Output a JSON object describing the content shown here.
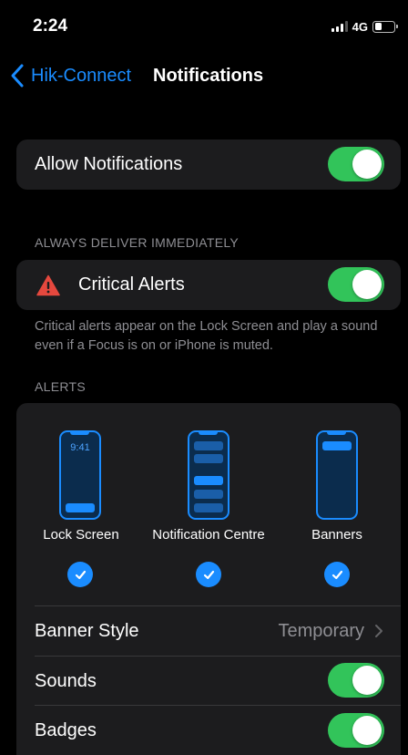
{
  "status_bar": {
    "time": "2:24",
    "network": "4G"
  },
  "nav": {
    "back_label": "Hik-Connect",
    "title": "Notifications"
  },
  "allow": {
    "label": "Allow Notifications",
    "on": true
  },
  "always_deliver": {
    "header": "ALWAYS DELIVER IMMEDIATELY",
    "critical_label": "Critical Alerts",
    "on": true,
    "footer": "Critical alerts appear on the Lock Screen and play a sound even if a Focus is on or iPhone is muted."
  },
  "alerts": {
    "header": "ALERTS",
    "styles": [
      {
        "label": "Lock Screen",
        "checked": true,
        "preview_time": "9:41"
      },
      {
        "label": "Notification Centre",
        "checked": true
      },
      {
        "label": "Banners",
        "checked": true
      }
    ],
    "banner_style": {
      "label": "Banner Style",
      "value": "Temporary"
    },
    "sounds": {
      "label": "Sounds",
      "on": true
    },
    "badges": {
      "label": "Badges",
      "on": true
    }
  },
  "colors": {
    "accent": "#1a8cff",
    "toggle_on": "#32c45a",
    "warning": "#e5483e",
    "group_bg": "#1c1c1e",
    "secondary_text": "#8e8e93"
  },
  "icons": {
    "back": "chevron-left-icon",
    "critical": "warning-triangle-icon",
    "check": "checkmark-icon",
    "disclosure": "chevron-right-icon"
  }
}
